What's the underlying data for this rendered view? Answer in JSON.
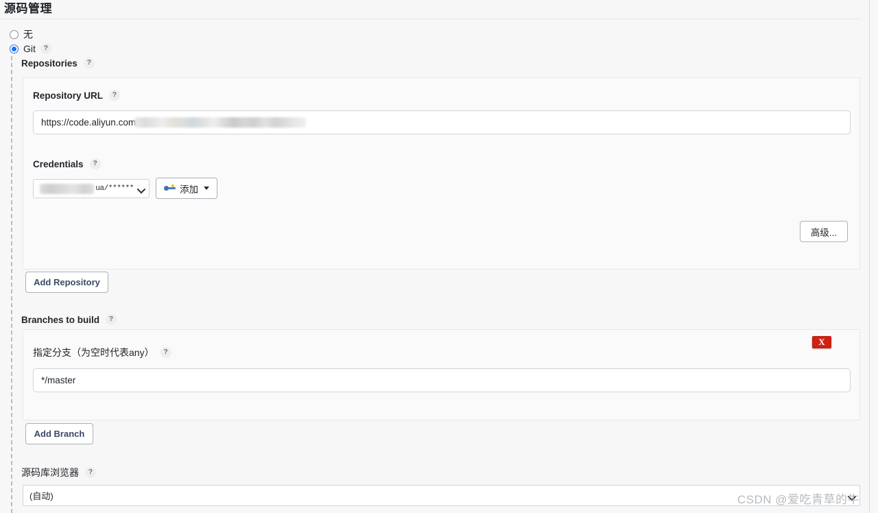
{
  "section": {
    "title": "源码管理"
  },
  "scm_options": [
    {
      "label": "无",
      "checked": false
    },
    {
      "label": "Git",
      "checked": true
    }
  ],
  "repositories": {
    "label": "Repositories",
    "help": "?",
    "repository_url": {
      "label": "Repository URL",
      "help": "?",
      "value_visible": "https://code.aliyun.com",
      "redacted": true
    },
    "credentials": {
      "label": "Credentials",
      "help": "?",
      "selected": "ua/******",
      "selected_prefix_redacted": true,
      "add_button": {
        "label": "添加",
        "icon": "key-icon",
        "has_dropdown": true
      }
    },
    "advanced_button": {
      "label": "高级..."
    },
    "add_repository_button": {
      "label": "Add Repository"
    }
  },
  "branches": {
    "label": "Branches to build",
    "help": "?",
    "branch_spec": {
      "label": "指定分支（为空时代表any）",
      "help": "?",
      "value": "*/master"
    },
    "delete_button": {
      "label": "X"
    },
    "add_branch_button": {
      "label": "Add Branch"
    }
  },
  "repository_browser": {
    "label": "源码库浏览器",
    "help": "?",
    "selected": "(自动)"
  },
  "watermark": {
    "text": "CSDN @爱吃青草的牛"
  },
  "colors": {
    "accent": "#1f6feb",
    "danger": "#d32011",
    "page_bg": "#f7f7f7",
    "panel_bg": "#fafafa",
    "border": "#e6e8ea",
    "input_border": "#cdd3d9"
  }
}
